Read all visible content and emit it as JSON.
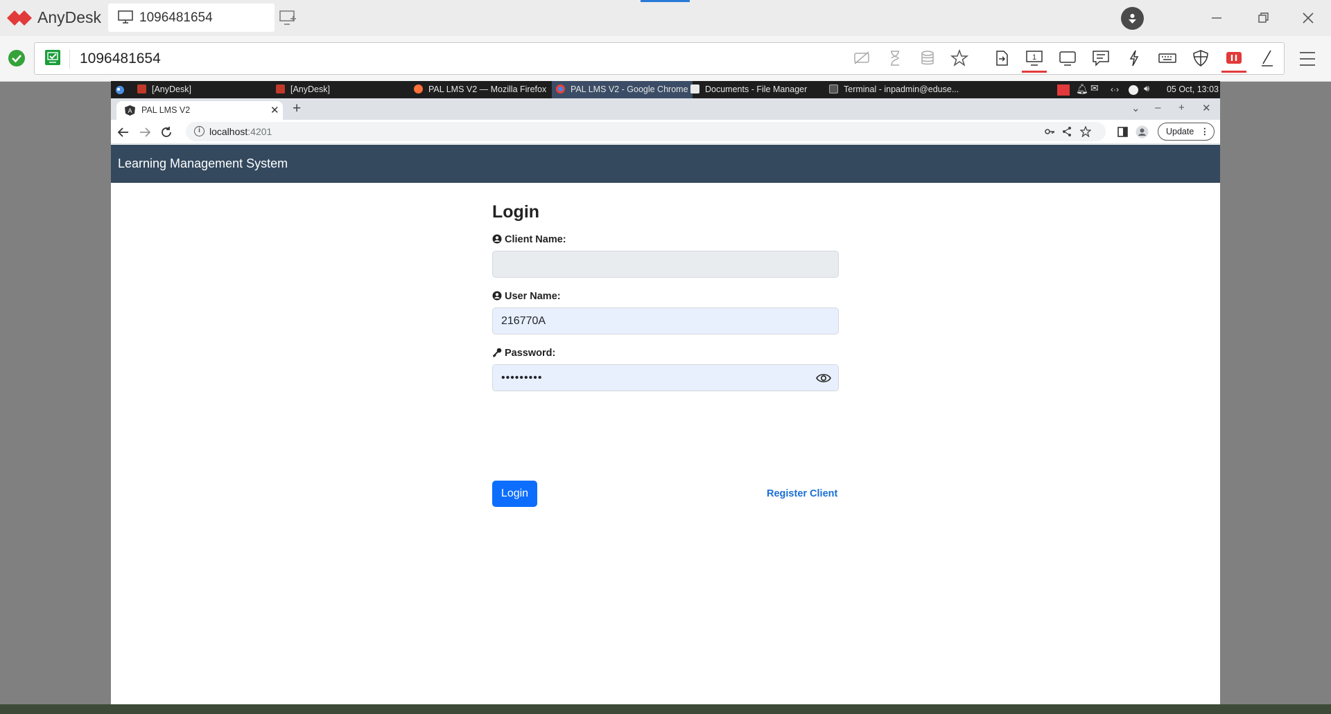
{
  "anydesk": {
    "app_name": "AnyDesk",
    "tab_label": "1096481654",
    "address": "1096481654",
    "colors": {
      "brand": "#e23a3a",
      "ok": "#35a23a"
    },
    "toolbar_icons": [
      "privacy-icon",
      "hourglass-icon",
      "database-icon",
      "star-icon",
      "file-transfer-icon",
      "monitor-1-icon",
      "display-icon",
      "chat-icon",
      "lightning-icon",
      "keyboard-icon",
      "shield-icon",
      "recording-icon",
      "pen-icon",
      "menu-icon"
    ],
    "monitor_number": "1"
  },
  "panel": {
    "tasks": [
      {
        "label": "[AnyDesk]"
      },
      {
        "label": "[AnyDesk]"
      },
      {
        "label": "PAL LMS V2 — Mozilla Firefox"
      },
      {
        "label": "PAL LMS V2 - Google Chrome"
      },
      {
        "label": "Documents - File Manager"
      },
      {
        "label": "Terminal - inpadmin@eduse..."
      }
    ],
    "clock": "05 Oct, 13:03"
  },
  "chrome": {
    "tab_title": "PAL LMS V2",
    "url_host": "localhost",
    "url_port": ":4201",
    "update_label": "Update"
  },
  "app": {
    "header_title": "Learning Management System",
    "login_title": "Login",
    "client_label": "Client Name:",
    "client_value": "",
    "user_label": "User Name:",
    "user_value": "216770A",
    "password_label": "Password:",
    "password_value": "•••••••••",
    "login_button": "Login",
    "register_link": "Register Client",
    "colors": {
      "header_bg": "#34495e",
      "primary": "#0d6efd"
    }
  }
}
